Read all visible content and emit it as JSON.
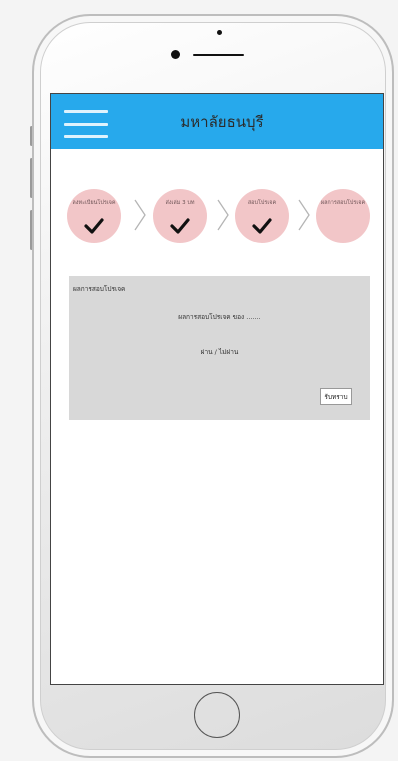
{
  "app": {
    "title": "มหาลัยธนบุรี",
    "header_color": "#27a9ec",
    "menu_icon": "hamburger-menu-icon"
  },
  "steps": [
    {
      "label": "ลงทะเบียนโปรเจค",
      "completed": true,
      "icon": "checkmark-icon"
    },
    {
      "label": "ส่งเล่ม 3 บท",
      "completed": true,
      "icon": "checkmark-icon"
    },
    {
      "label": "สอบโปรเจค",
      "completed": true,
      "icon": "checkmark-icon"
    },
    {
      "label": "ผลการสอบโปรเจค",
      "completed": false
    }
  ],
  "step_color": "#f2c6c8",
  "result_card": {
    "title": "ผลการสอบโปรเจค",
    "result_text": "ผลการสอบโปรเจค ของ .......",
    "status_text": "ผ่าน / ไม่ผ่าน",
    "ack_button_label": "รับทราบ"
  }
}
